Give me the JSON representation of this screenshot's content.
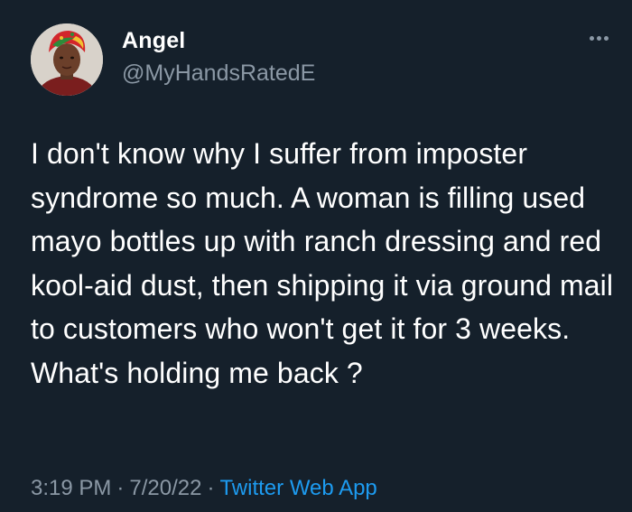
{
  "author": {
    "name": "Angel",
    "handle": "@MyHandsRatedE"
  },
  "tweet": {
    "text": "I don't know why I suffer from imposter syndrome so much. A woman is filling used mayo bottles up with ranch dressing and red kool-aid dust, then shipping it via ground mail to customers who won't get it for 3 weeks. What's holding me back ?"
  },
  "meta": {
    "time": "3:19 PM",
    "separator": "·",
    "date": "7/20/22",
    "source": "Twitter Web App"
  },
  "icons": {
    "more": "more-options-icon"
  },
  "colors": {
    "background": "#15202b",
    "text": "#ffffff",
    "secondary": "#8b98a5",
    "link": "#1d9bf0"
  }
}
